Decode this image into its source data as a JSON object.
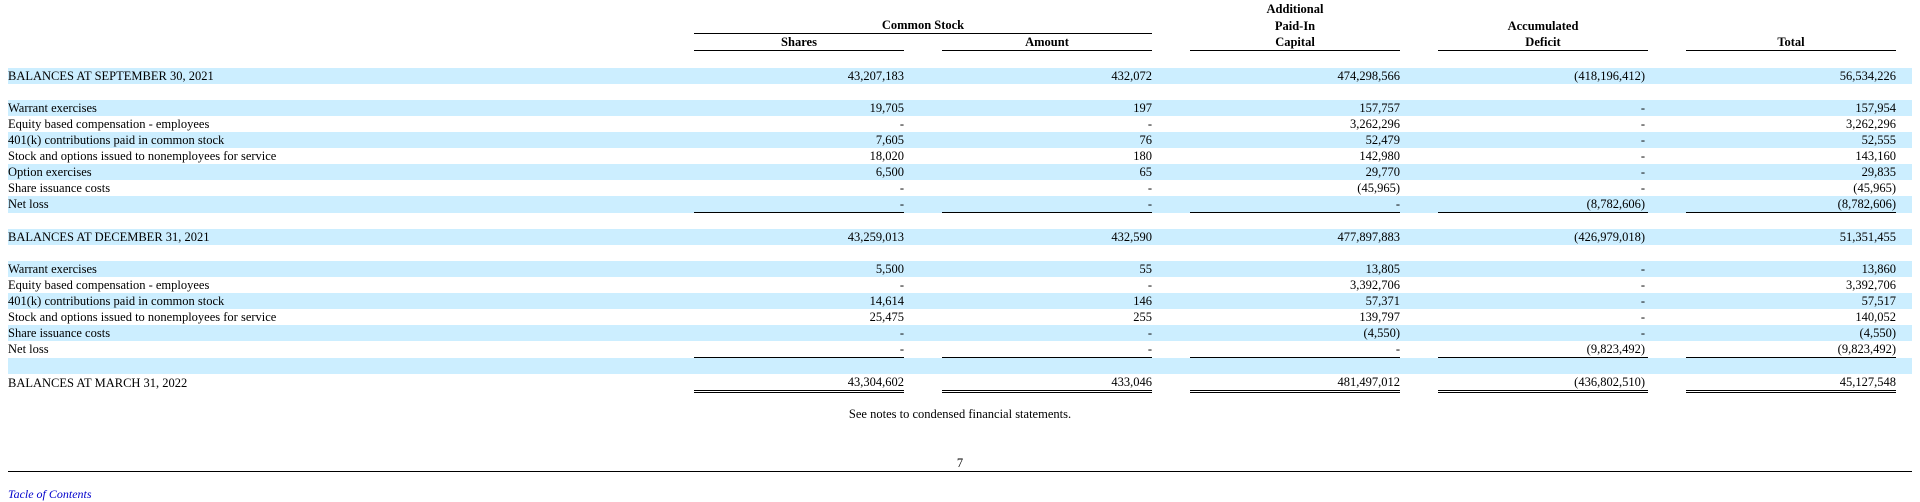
{
  "header": {
    "common_stock": "Common Stock",
    "shares": "Shares",
    "amount": "Amount",
    "apic_1": "Additional",
    "apic_2": "Paid-In",
    "apic_3": "Capital",
    "deficit_1": "Accumulated",
    "deficit_2": "Deficit",
    "total": "Total"
  },
  "rows": [
    {
      "label": "BALANCES AT SEPTEMBER 30, 2021",
      "shares": "43,207,183",
      "amount": "432,072",
      "apic": "474,298,566",
      "deficit": "(418,196,412)",
      "total": "56,534,226"
    },
    {
      "label": "Warrant exercises",
      "shares": "19,705",
      "amount": "197",
      "apic": "157,757",
      "deficit": "-",
      "total": "157,954"
    },
    {
      "label": "Equity based compensation - employees",
      "shares": "-",
      "amount": "-",
      "apic": "3,262,296",
      "deficit": "-",
      "total": "3,262,296"
    },
    {
      "label": "401(k) contributions paid in common stock",
      "shares": "7,605",
      "amount": "76",
      "apic": "52,479",
      "deficit": "-",
      "total": "52,555"
    },
    {
      "label": "Stock and options issued to nonemployees for service",
      "shares": "18,020",
      "amount": "180",
      "apic": "142,980",
      "deficit": "-",
      "total": "143,160"
    },
    {
      "label": "Option exercises",
      "shares": "6,500",
      "amount": "65",
      "apic": "29,770",
      "deficit": "-",
      "total": "29,835"
    },
    {
      "label": "Share issuance costs",
      "shares": "-",
      "amount": "-",
      "apic": "(45,965)",
      "deficit": "-",
      "total": "(45,965)"
    },
    {
      "label": "Net loss",
      "shares": "-",
      "amount": "-",
      "apic": "-",
      "deficit": "(8,782,606)",
      "total": "(8,782,606)"
    },
    {
      "label": "BALANCES AT DECEMBER 31, 2021",
      "shares": "43,259,013",
      "amount": "432,590",
      "apic": "477,897,883",
      "deficit": "(426,979,018)",
      "total": "51,351,455"
    },
    {
      "label": "Warrant exercises",
      "shares": "5,500",
      "amount": "55",
      "apic": "13,805",
      "deficit": "-",
      "total": "13,860"
    },
    {
      "label": "Equity based compensation - employees",
      "shares": "-",
      "amount": "-",
      "apic": "3,392,706",
      "deficit": "-",
      "total": "3,392,706"
    },
    {
      "label": "401(k) contributions paid in common stock",
      "shares": "14,614",
      "amount": "146",
      "apic": "57,371",
      "deficit": "-",
      "total": "57,517"
    },
    {
      "label": "Stock and options issued to nonemployees for service",
      "shares": "25,475",
      "amount": "255",
      "apic": "139,797",
      "deficit": "-",
      "total": "140,052"
    },
    {
      "label": "Share issuance costs",
      "shares": "-",
      "amount": "-",
      "apic": "(4,550)",
      "deficit": "-",
      "total": "(4,550)"
    },
    {
      "label": "Net loss",
      "shares": "-",
      "amount": "-",
      "apic": "-",
      "deficit": "(9,823,492)",
      "total": "(9,823,492)"
    },
    {
      "label": "BALANCES AT MARCH 31, 2022",
      "shares": "43,304,602",
      "amount": "433,046",
      "apic": "481,497,012",
      "deficit": "(436,802,510)",
      "total": "45,127,548"
    }
  ],
  "footnote": "See notes to condensed financial statements.",
  "page_number": "7",
  "toc_link": "Tacle of Contents"
}
